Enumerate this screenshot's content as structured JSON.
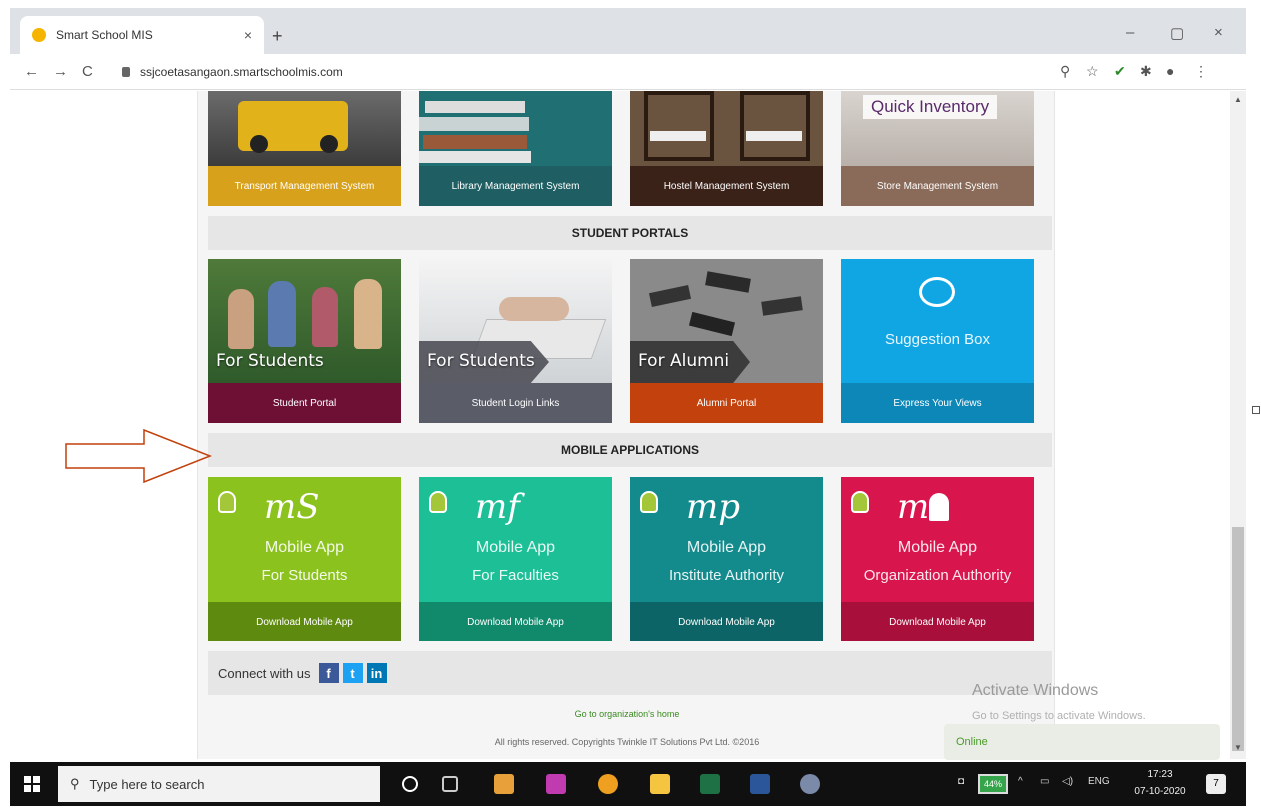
{
  "browser": {
    "tab_title": "Smart School MIS",
    "tab_close": "×",
    "new_tab": "+",
    "url": "ssjcoetasangaon.smartschoolmis.com",
    "window_min": "–",
    "window_restore": "▢",
    "window_close": "×"
  },
  "top_row": {
    "quick_inventory": "Quick Inventory",
    "cards": [
      {
        "caption": "Transport Management System",
        "color": "#d8a11c"
      },
      {
        "caption": "Library Management System",
        "color": "#1f5f63"
      },
      {
        "caption": "Hostel Management System",
        "color": "#3a2218"
      },
      {
        "caption": "Store Management System",
        "color": "#8a6a58"
      }
    ]
  },
  "student_portals": {
    "heading": "STUDENT PORTALS",
    "cards": [
      {
        "title": "For Students",
        "caption": "Student Portal",
        "color": "#6e0f34"
      },
      {
        "title": "For Students",
        "caption": "Student Login Links",
        "color": "#5a5c68"
      },
      {
        "title": "For Alumni",
        "caption": "Alumni Portal",
        "color": "#c2410c"
      },
      {
        "title": "Suggestion Box",
        "caption": "Express Your Views",
        "color": "#0d86b8"
      }
    ]
  },
  "mobile_apps": {
    "heading": "MOBILE APPLICATIONS",
    "cards": [
      {
        "brand": "mS",
        "line1": "Mobile App",
        "line2": "For Students",
        "caption": "Download Mobile App",
        "color": "#8cc21e",
        "caption_color": "#5f8a10"
      },
      {
        "brand": "mf",
        "line1": "Mobile App",
        "line2": "For Faculties",
        "caption": "Download Mobile App",
        "color": "#1dbf97",
        "caption_color": "#118a6c"
      },
      {
        "brand": "mp",
        "line1": "Mobile App",
        "line2": "Institute Authority",
        "caption": "Download Mobile App",
        "color": "#138a8c",
        "caption_color": "#0d6466"
      },
      {
        "brand": "m",
        "line1": "Mobile App",
        "line2": "Organization Authority",
        "caption": "Download Mobile App",
        "color": "#d8154d",
        "caption_color": "#a80f3a"
      }
    ]
  },
  "footer": {
    "connect": "Connect with us",
    "home_link": "Go to organization's home",
    "copyright": "All rights reserved. Copyrights Twinkle IT Solutions Pvt Ltd. ©2016"
  },
  "overlay": {
    "activate_title": "Activate Windows",
    "activate_sub": "Go to Settings to activate Windows.",
    "online": "Online"
  },
  "taskbar": {
    "search_placeholder": "Type here to search",
    "battery": "44%",
    "lang": "ENG",
    "time": "17:23",
    "date": "07-10-2020",
    "notification_count": "7"
  }
}
